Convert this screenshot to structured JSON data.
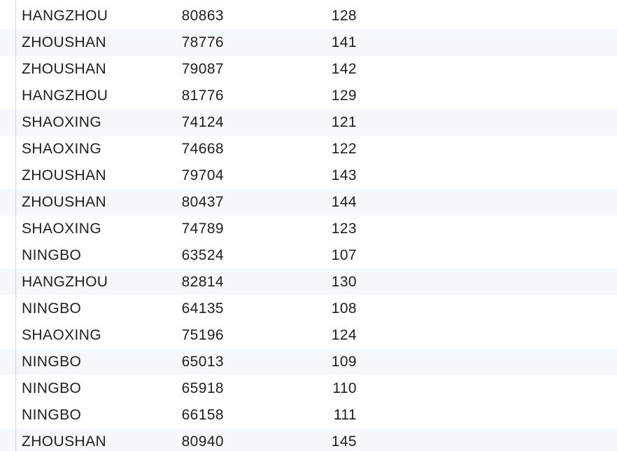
{
  "table": {
    "rows": [
      {
        "city": "HANGZHOU",
        "value1": "80863",
        "value2": "128"
      },
      {
        "city": "ZHOUSHAN",
        "value1": "78776",
        "value2": "141"
      },
      {
        "city": "ZHOUSHAN",
        "value1": "79087",
        "value2": "142"
      },
      {
        "city": "HANGZHOU",
        "value1": "81776",
        "value2": "129"
      },
      {
        "city": "SHAOXING",
        "value1": "74124",
        "value2": "121"
      },
      {
        "city": "SHAOXING",
        "value1": "74668",
        "value2": "122"
      },
      {
        "city": "ZHOUSHAN",
        "value1": "79704",
        "value2": "143"
      },
      {
        "city": "ZHOUSHAN",
        "value1": "80437",
        "value2": "144"
      },
      {
        "city": "SHAOXING",
        "value1": "74789",
        "value2": "123"
      },
      {
        "city": "NINGBO",
        "value1": "63524",
        "value2": "107"
      },
      {
        "city": "HANGZHOU",
        "value1": "82814",
        "value2": "130"
      },
      {
        "city": "NINGBO",
        "value1": "64135",
        "value2": "108"
      },
      {
        "city": "SHAOXING",
        "value1": "75196",
        "value2": "124"
      },
      {
        "city": "NINGBO",
        "value1": "65013",
        "value2": "109"
      },
      {
        "city": "NINGBO",
        "value1": "65918",
        "value2": "110"
      },
      {
        "city": "NINGBO",
        "value1": "66158",
        "value2": "111"
      },
      {
        "city": "ZHOUSHAN",
        "value1": "80940",
        "value2": "145"
      }
    ]
  },
  "colors": {
    "alt_row_bg": "#f4f7fb",
    "divider": "#d7d7d7",
    "text": "#1f1f1f"
  }
}
